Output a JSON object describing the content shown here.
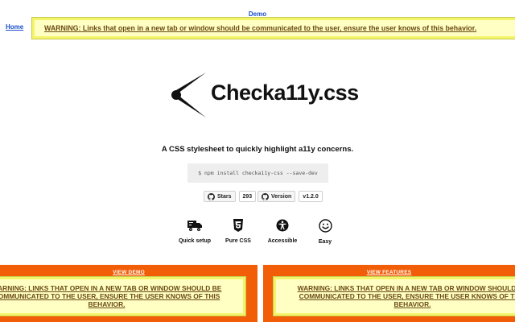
{
  "nav": {
    "demo_label": "Demo",
    "home_label": "Home"
  },
  "warning_banner": "WARNING: Links that open in a new tab or window should be communicated to the user, ensure the user knows of this behavior.",
  "logo": {
    "text": "Checka11y.css",
    "icon": "accessibility-logo-icon"
  },
  "tagline": "A CSS stylesheet to quickly highlight a11y concerns.",
  "install_command": "$ npm install checka11y-css --save-dev",
  "badges": {
    "stars_label": "Stars",
    "stars_count": "293",
    "version_label": "Version",
    "version_value": "v1.2.0"
  },
  "features": [
    {
      "label": "Quick setup",
      "icon": "truck-icon"
    },
    {
      "label": "Pure CSS",
      "icon": "css3-icon"
    },
    {
      "label": "Accessible",
      "icon": "accessibility-icon"
    },
    {
      "label": "Easy",
      "icon": "smile-icon"
    }
  ],
  "panels": [
    {
      "title": "VIEW DEMO",
      "warning": "WARNING: LINKS THAT OPEN IN A NEW TAB OR WINDOW SHOULD BE COMMUNICATED TO THE USER, ENSURE THE USER KNOWS OF THIS BEHAVIOR."
    },
    {
      "title": "VIEW FEATURES",
      "warning": "WARNING: LINKS THAT OPEN IN A NEW TAB OR WINDOW SHOULD BE COMMUNICATED TO THE USER, ENSURE THE USER KNOWS OF THIS BEHAVIOR."
    }
  ],
  "colors": {
    "warning_bg": "#ffffc4",
    "warning_border": "#f4f46a",
    "warning_text": "#6a4a12",
    "panel_bg": "#f25d07",
    "link": "#1a4ec8"
  }
}
